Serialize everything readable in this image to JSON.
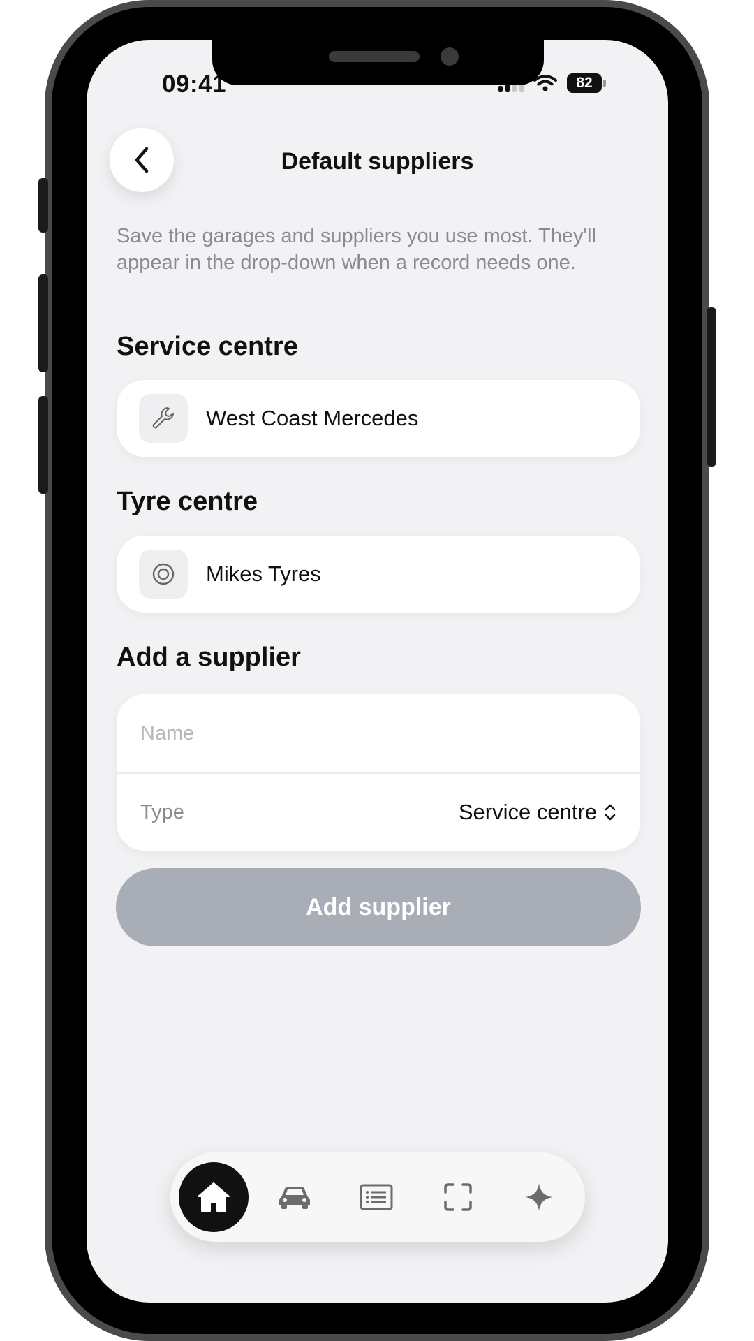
{
  "status_bar": {
    "time": "09:41",
    "battery": "82"
  },
  "header": {
    "title": "Default suppliers"
  },
  "description": "Save the garages and suppliers you use most. They'll appear in the drop-down when a record needs one.",
  "sections": {
    "service_centre": {
      "title": "Service centre",
      "supplier": "West Coast Mercedes",
      "icon": "wrench-icon"
    },
    "tyre_centre": {
      "title": "Tyre centre",
      "supplier": "Mikes Tyres",
      "icon": "tyre-icon"
    },
    "add_supplier": {
      "title": "Add a supplier",
      "name_placeholder": "Name",
      "type_label": "Type",
      "type_value": "Service centre",
      "button_label": "Add supplier"
    }
  },
  "tab_bar": {
    "active_tab": "home",
    "tabs": [
      {
        "id": "home",
        "icon": "home-icon"
      },
      {
        "id": "vehicles",
        "icon": "car-icon"
      },
      {
        "id": "records",
        "icon": "list-icon"
      },
      {
        "id": "scan",
        "icon": "scan-icon"
      },
      {
        "id": "assistant",
        "icon": "sparkle-icon"
      }
    ]
  },
  "colors": {
    "background": "#f2f2f4",
    "button_disabled": "#a9adb5",
    "active_tab": "#111111"
  }
}
